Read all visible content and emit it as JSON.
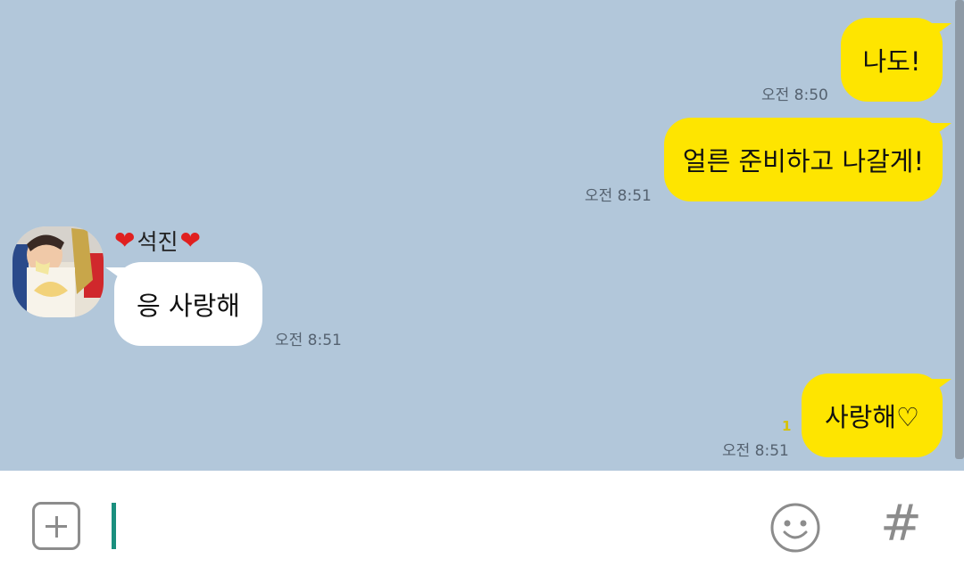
{
  "messages": [
    {
      "side": "me",
      "text": "나도!",
      "time": "오전 8:50"
    },
    {
      "side": "me",
      "text": "얼른 준비하고 나갈게!",
      "time": "오전 8:51"
    },
    {
      "side": "them",
      "sender": "석진",
      "text": "응 사랑해",
      "time": "오전 8:51"
    },
    {
      "side": "me",
      "text": "사랑해♡",
      "time": "오전 8:51",
      "unread": "1"
    }
  ],
  "sender_heart": "❤",
  "input": {
    "value": "",
    "placeholder": ""
  },
  "icons": {
    "attach": "plus-square-icon",
    "emoji": "smiley-icon",
    "hashtag": "hash-icon",
    "hash_glyph": "#"
  },
  "colors": {
    "chat_bg": "#b2c7da",
    "my_bubble": "#fee500",
    "their_bubble": "#ffffff",
    "caret": "#1a8f7e"
  }
}
